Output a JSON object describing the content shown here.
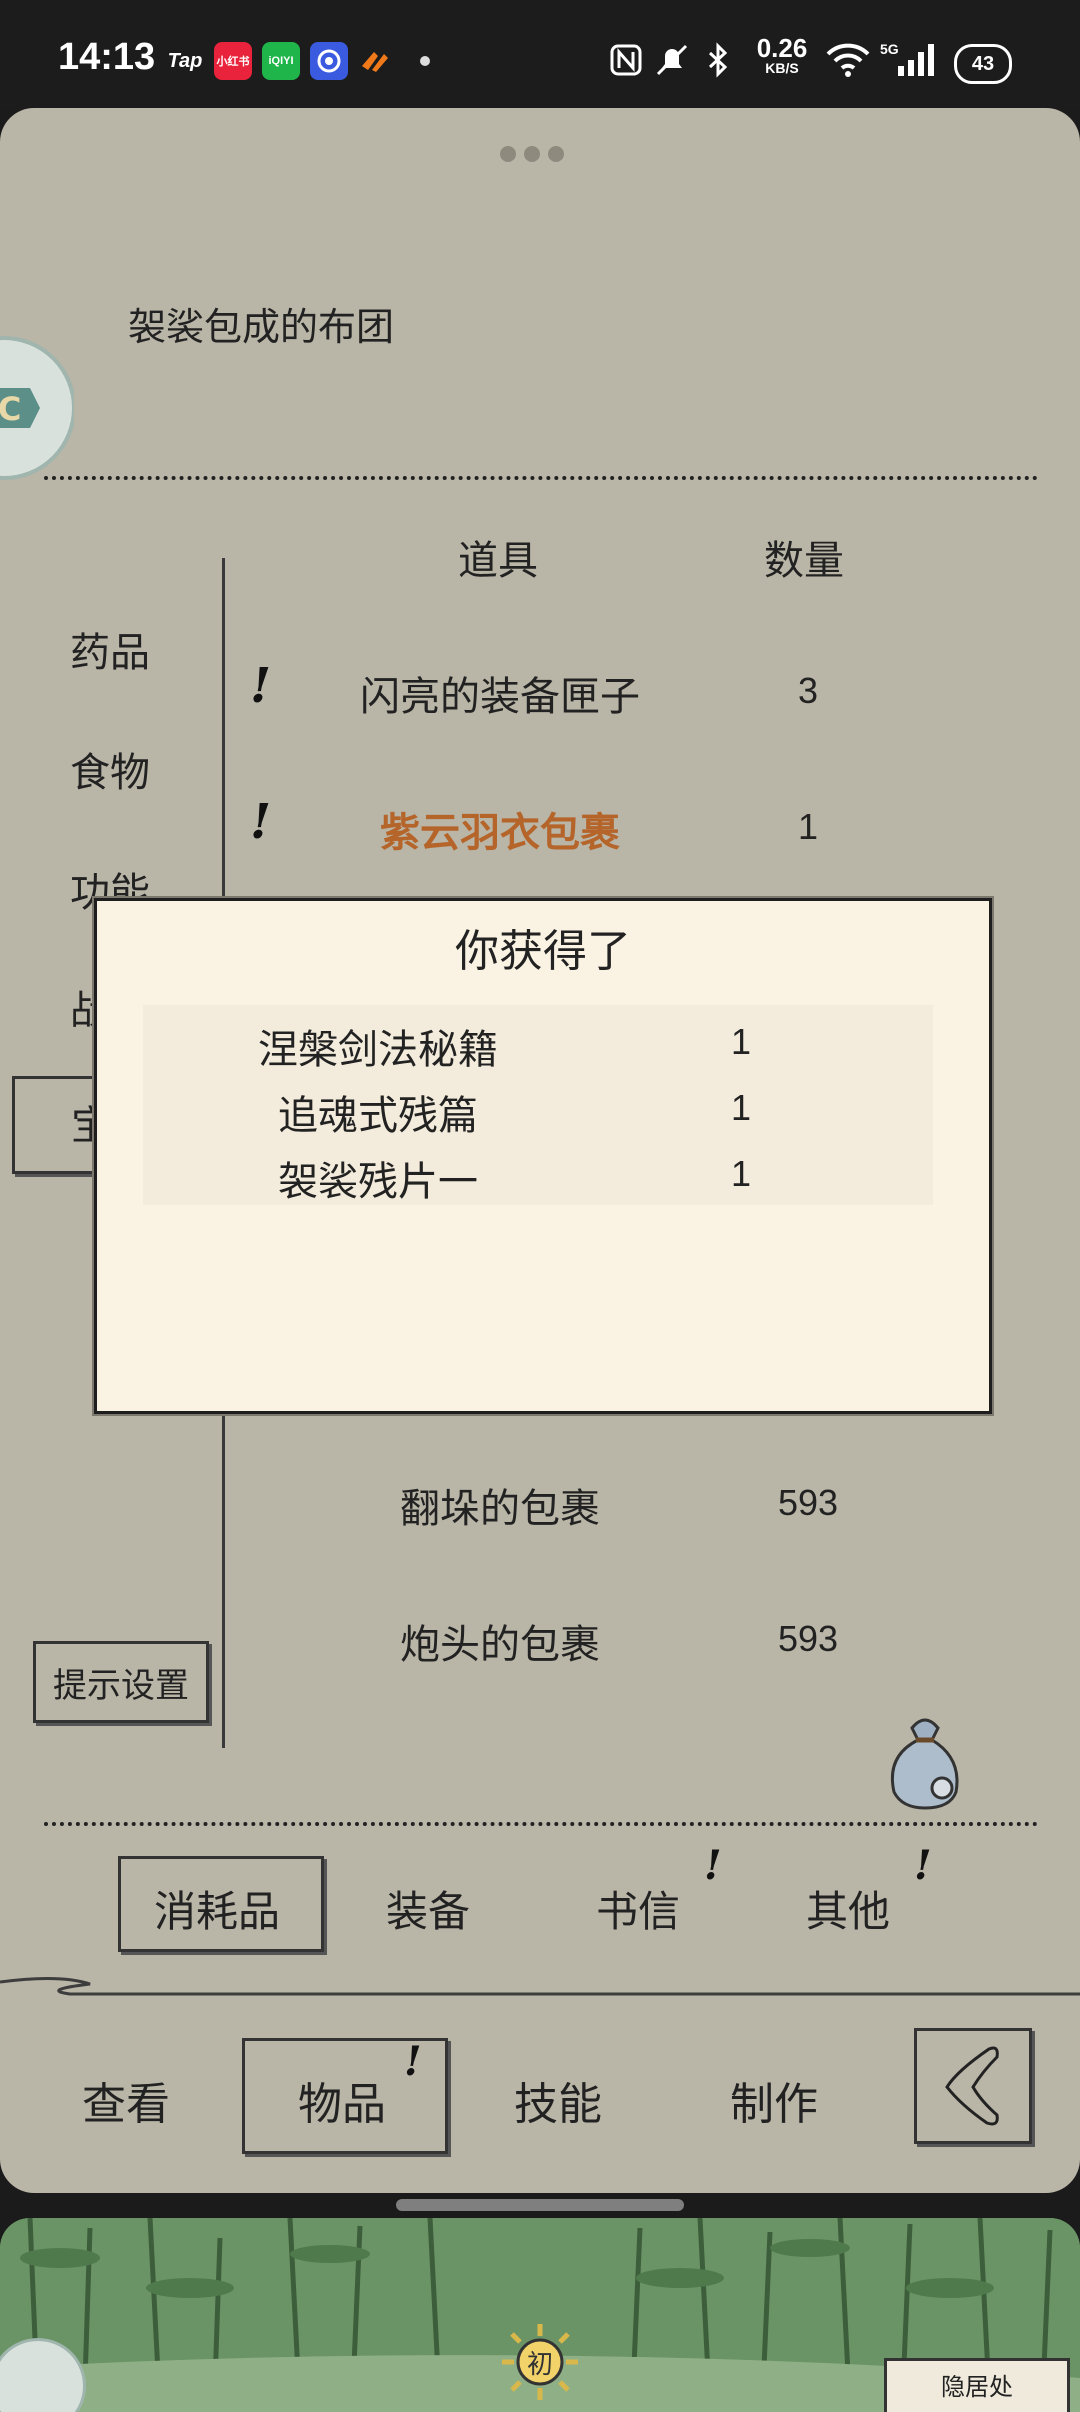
{
  "status_bar": {
    "time": "14:13",
    "apps": [
      {
        "name": "Tap",
        "color": "#1c1c1c"
      },
      {
        "name": "小红书",
        "color": "#e8233b"
      },
      {
        "name": "iQIYI",
        "color": "#1fb54a"
      },
      {
        "name": "",
        "color": "#3a5be0"
      },
      {
        "name": "",
        "color": "#f07a1a"
      }
    ],
    "net_speed": "0.26",
    "net_unit": "KB/S",
    "battery": "43"
  },
  "inventory": {
    "selected_item_title": "袈裟包成的布团",
    "header_item": "道具",
    "header_qty": "数量",
    "categories": [
      "药品",
      "食物",
      "功能",
      "战",
      "宝"
    ],
    "rows": [
      {
        "name": "闪亮的装备匣子",
        "qty": "3",
        "alert": "!"
      },
      {
        "name": "紫云羽衣包裹",
        "qty": "1",
        "alert": "!",
        "highlight_color": "#b5652a"
      },
      {
        "name": "翻垛的包裹",
        "qty": "593",
        "alert": ""
      },
      {
        "name": "炮头的包裹",
        "qty": "593",
        "alert": ""
      }
    ],
    "hint_button": "提示设置"
  },
  "sub_tabs": [
    {
      "label": "消耗品",
      "selected": true,
      "alert": ""
    },
    {
      "label": "装备",
      "selected": false,
      "alert": ""
    },
    {
      "label": "书信",
      "selected": false,
      "alert": "!"
    },
    {
      "label": "其他",
      "selected": false,
      "alert": "!"
    }
  ],
  "nav_tabs": [
    {
      "label": "查看",
      "selected": false,
      "alert": ""
    },
    {
      "label": "物品",
      "selected": true,
      "alert": "!"
    },
    {
      "label": "技能",
      "selected": false,
      "alert": ""
    },
    {
      "label": "制作",
      "selected": false,
      "alert": ""
    }
  ],
  "dialog": {
    "title": "你获得了",
    "rewards": [
      {
        "name": "涅槃剑法秘籍",
        "qty": "1"
      },
      {
        "name": "追魂式残篇",
        "qty": "1"
      },
      {
        "name": "袈裟残片一",
        "qty": "1"
      }
    ]
  },
  "scene": {
    "location": "隐居处",
    "emblem_text": "初"
  },
  "colors": {
    "panel_bg": "#b9b5a7",
    "dialog_bg": "#faf3e3",
    "highlight": "#b5652a"
  }
}
